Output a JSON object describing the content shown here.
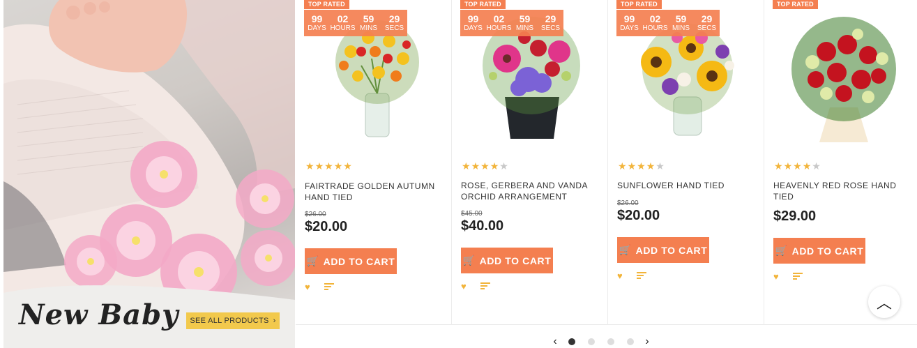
{
  "banner": {
    "title": "New Baby",
    "button_label": "SEE ALL PRODUCTS",
    "button_icon": "chevron-right-icon"
  },
  "products": [
    {
      "badge": "TOP RATED",
      "timer": [
        {
          "value": "99",
          "unit": "DAYS"
        },
        {
          "value": "02",
          "unit": "HOURS"
        },
        {
          "value": "59",
          "unit": "MINS"
        },
        {
          "value": "29",
          "unit": "SECS"
        }
      ],
      "rating": 4.5,
      "name": "FAIRTRADE GOLDEN AUTUMN HAND TIED",
      "old_price": "$26.00",
      "price": "$20.00",
      "cart_label": "ADD TO CART"
    },
    {
      "badge": "TOP RATED",
      "timer": [
        {
          "value": "99",
          "unit": "DAYS"
        },
        {
          "value": "02",
          "unit": "HOURS"
        },
        {
          "value": "59",
          "unit": "MINS"
        },
        {
          "value": "29",
          "unit": "SECS"
        }
      ],
      "rating": 3.5,
      "name": "ROSE, GERBERA AND VANDA ORCHID ARRANGEMENT",
      "old_price": "$45.00",
      "price": "$40.00",
      "cart_label": "ADD TO CART"
    },
    {
      "badge": "TOP RATED",
      "timer": [
        {
          "value": "99",
          "unit": "DAYS"
        },
        {
          "value": "02",
          "unit": "HOURS"
        },
        {
          "value": "59",
          "unit": "MINS"
        },
        {
          "value": "29",
          "unit": "SECS"
        }
      ],
      "rating": 3.5,
      "name": "SUNFLOWER HAND TIED",
      "old_price": "$26.00",
      "price": "$20.00",
      "cart_label": "ADD TO CART"
    },
    {
      "badge": "TOP RATED",
      "rating": 3.5,
      "name": "HEAVENLY RED ROSE HAND TIED",
      "price": "$29.00",
      "cart_label": "ADD TO CART"
    }
  ],
  "pager": {
    "pages": 4,
    "active": 1
  },
  "colors": {
    "accent": "#f47f50",
    "star": "#f2b43a",
    "banner_button": "#f2c94c"
  }
}
